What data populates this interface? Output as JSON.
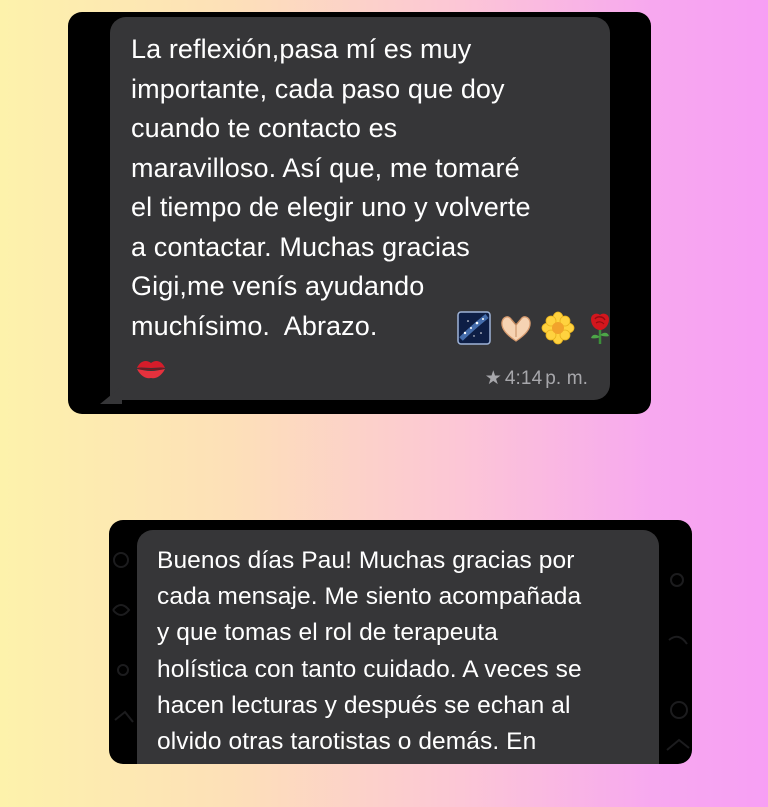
{
  "messages": [
    {
      "text": "La reflexión,pasa mí es muy\nimportante, cada paso que doy\ncuando te contacto es\nmaravilloso. Así que, me tomaré\nel tiempo de elegir uno y volverte\na contactar. Muchas gracias\nGigi,me venís ayudando\nmuchísimo.  Abrazo.",
      "emojis": [
        "milky-way",
        "heart-hands",
        "blossom",
        "rose",
        "kiss-mark"
      ],
      "starred": true,
      "star_glyph": "★",
      "time": "4:14",
      "time_suffix": "p. m."
    },
    {
      "text": "Buenos días Pau! Muchas gracias por\ncada mensaje. Me siento acompañada\ny que tomas el rol de terapeuta\nholística con tanto cuidado. A veces se\nhacen lecturas y después se echan al\nolvido otras tarotistas o demás. En"
    }
  ],
  "colors": {
    "bubble": "#363638",
    "card": "#000000",
    "meta_text": "#a7a7ab",
    "gradient_left": "#fdf2ab",
    "gradient_right": "#f79ff4"
  }
}
